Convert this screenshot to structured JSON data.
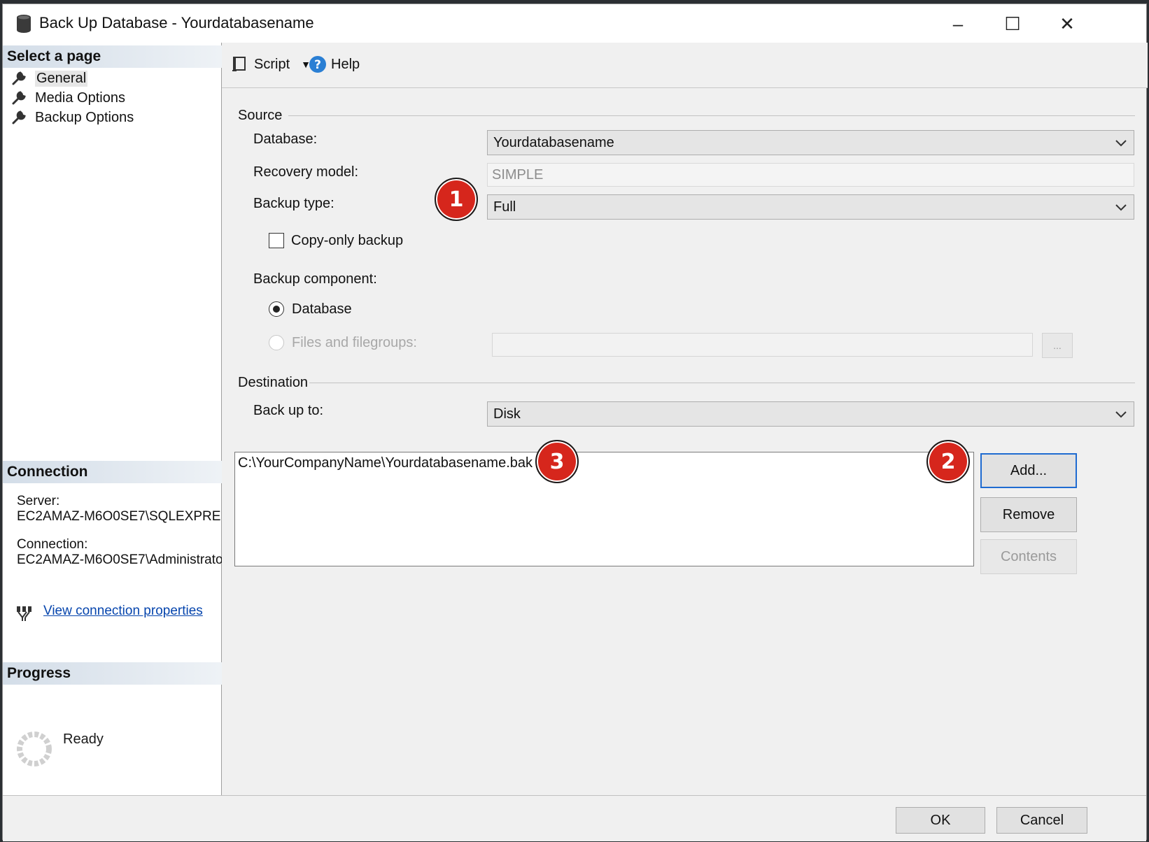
{
  "window": {
    "title": "Back Up Database - Yourdatabasename",
    "controls": {
      "minimize": "–",
      "maximize": "☐",
      "close": "✕"
    }
  },
  "sidebar": {
    "select_page_header": "Select a page",
    "pages": [
      {
        "label": "General",
        "icon": "wrench-icon",
        "selected": true
      },
      {
        "label": "Media Options",
        "icon": "wrench-icon",
        "selected": false
      },
      {
        "label": "Backup Options",
        "icon": "wrench-icon",
        "selected": false
      }
    ],
    "connection_header": "Connection",
    "server_label": "Server:",
    "server_value": "EC2AMAZ-M6O0SE7\\SQLEXPRE",
    "connection_label": "Connection:",
    "connection_value": "EC2AMAZ-M6O0SE7\\Administrato",
    "view_connection_link": "View connection properties",
    "progress_header": "Progress",
    "progress_status": "Ready"
  },
  "toolbar": {
    "script_label": "Script",
    "help_label": "Help"
  },
  "source": {
    "group_label": "Source",
    "database_label": "Database:",
    "database_value": "Yourdatabasename",
    "recovery_model_label": "Recovery model:",
    "recovery_model_value": "SIMPLE",
    "backup_type_label": "Backup type:",
    "backup_type_value": "Full",
    "copy_only_label": "Copy-only backup",
    "copy_only_checked": false,
    "backup_component_label": "Backup component:",
    "component_database_label": "Database",
    "component_files_label": "Files and filegroups:",
    "files_browse_label": "..."
  },
  "destination": {
    "group_label": "Destination",
    "back_up_to_label": "Back up to:",
    "back_up_to_value": "Disk",
    "files": [
      "C:\\YourCompanyName\\Yourdatabasename.bak"
    ],
    "add_label": "Add...",
    "remove_label": "Remove",
    "contents_label": "Contents"
  },
  "annotations": {
    "badge1": "1",
    "badge2": "2",
    "badge3": "3",
    "color": "#d6261c"
  },
  "footer": {
    "ok_label": "OK",
    "cancel_label": "Cancel"
  }
}
